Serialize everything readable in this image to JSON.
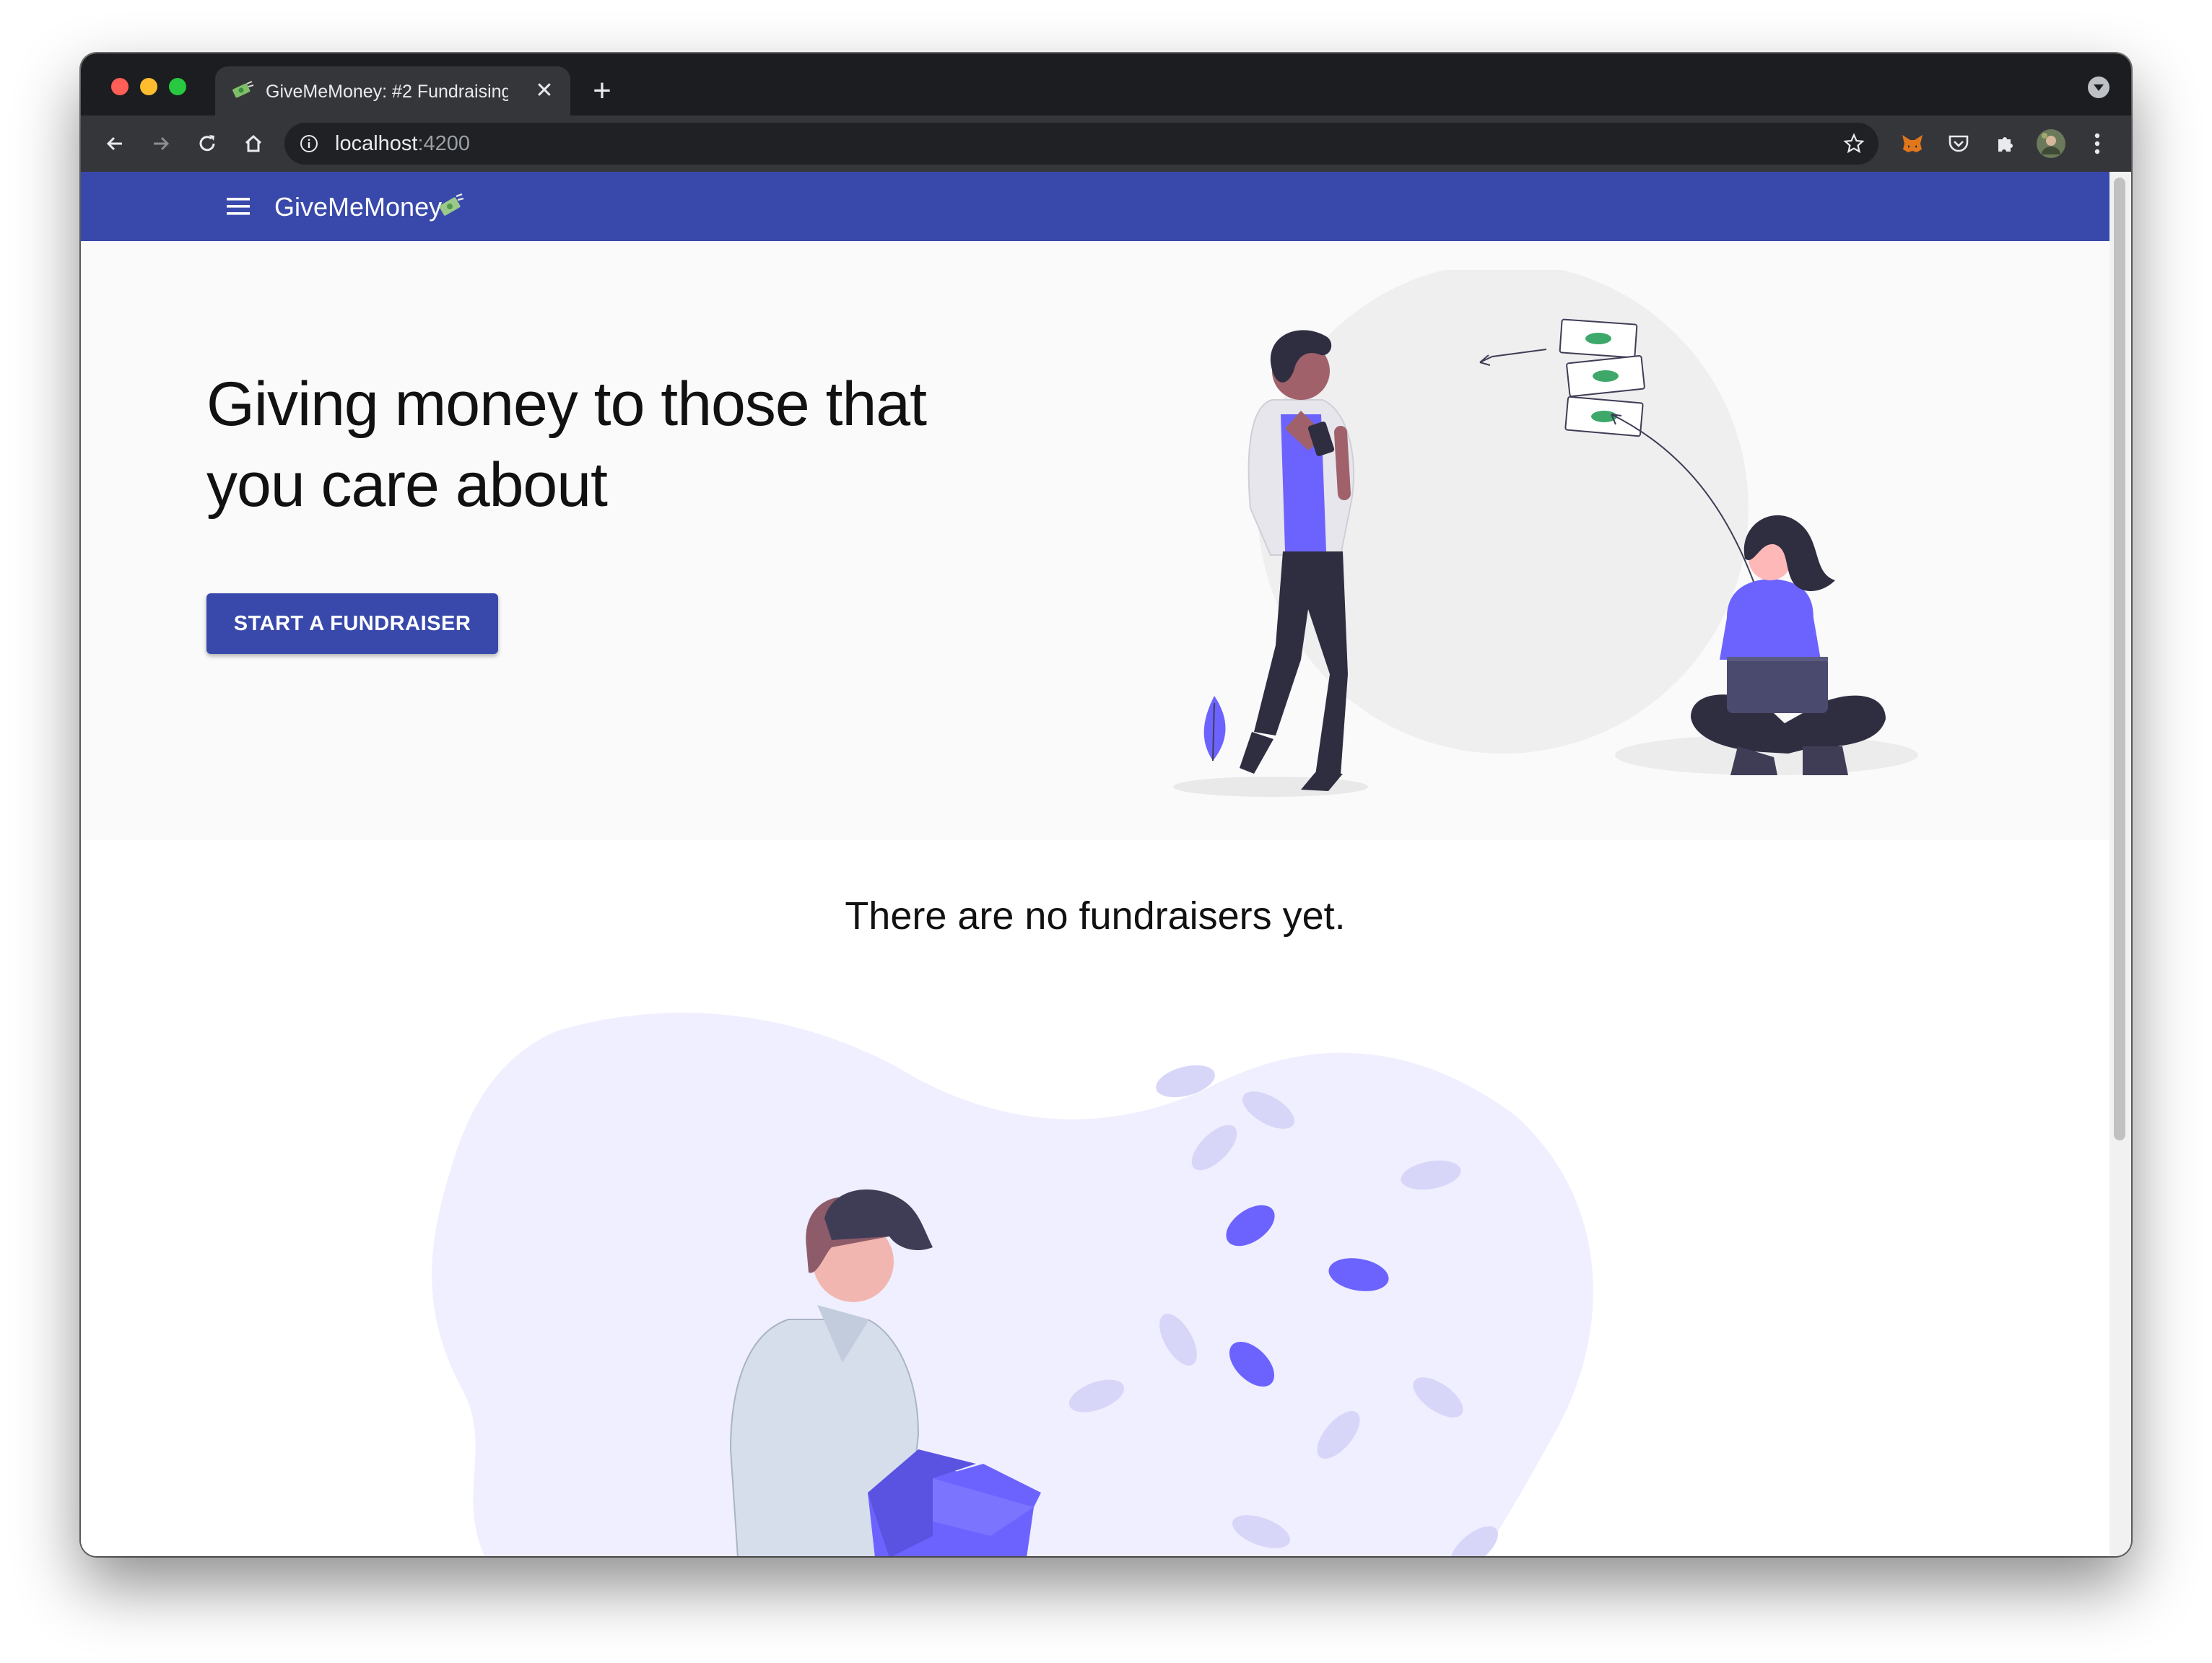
{
  "browser": {
    "tab_title": "GiveMeMoney: #2 Fundraising",
    "tab_close": "✕",
    "new_tab": "+",
    "url_host": "localhost",
    "url_port": ":4200"
  },
  "app": {
    "brand": "GiveMeMoney",
    "primary_color": "#3949ab",
    "accent_color": "#6c63ff"
  },
  "hero": {
    "title": "Giving money to those that you care about",
    "cta_label": "START A FUNDRAISER"
  },
  "empty_state": {
    "message": "There are no fundraisers yet."
  },
  "icons": [
    "back-icon",
    "forward-icon",
    "reload-icon",
    "home-icon",
    "info-icon",
    "star-icon",
    "metamask-icon",
    "pocket-icon",
    "extensions-icon",
    "profile-avatar",
    "kebab-menu-icon",
    "hamburger-menu-icon",
    "money-emoji-icon"
  ]
}
